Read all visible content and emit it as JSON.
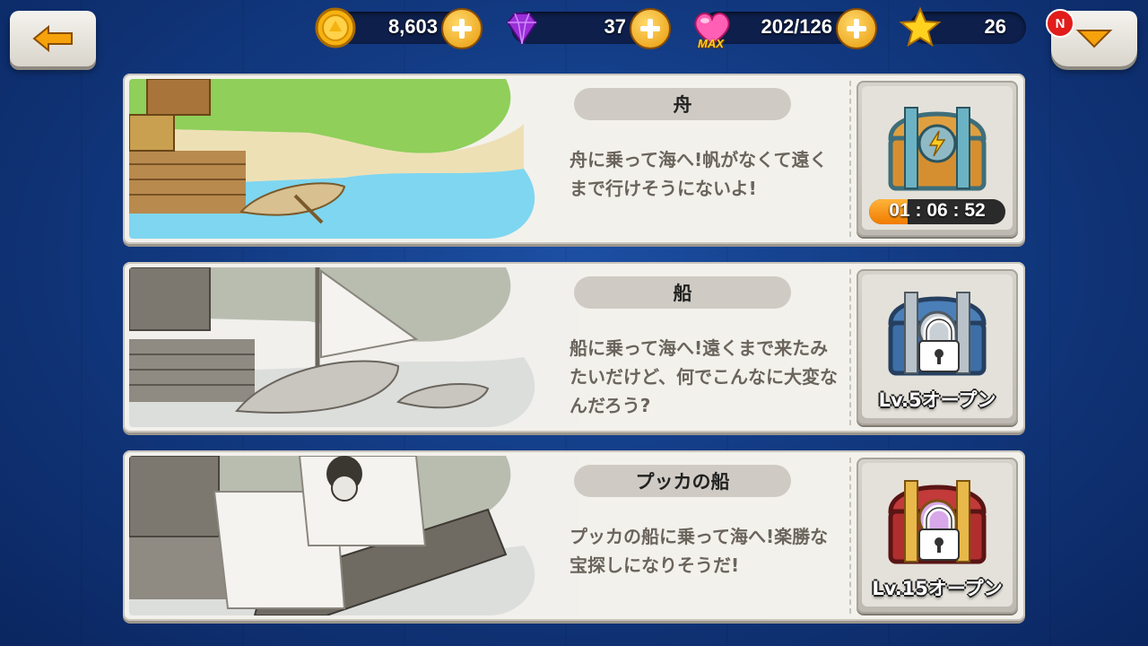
{
  "header": {
    "coins": "8,603",
    "gems": "37",
    "hearts": "202/126",
    "hearts_badge": "MAX",
    "stars": "26",
    "menu_badge": "N"
  },
  "colors": {
    "background": "#123a82",
    "card": "#f3f1ec",
    "plus": "#e89a0a",
    "badge": "#e21b1b"
  },
  "boats": [
    {
      "title": "舟",
      "description": "舟に乗って海へ!帆がなくて遠くまで行けそうにないよ!",
      "status": "01 : 06 : 52",
      "timer_progress": 0.28
    },
    {
      "title": "船",
      "description": "船に乗って海へ!遠くまで来たみたいだけど、何でこんなに大変なんだろう?",
      "status": "Lv.5オープン"
    },
    {
      "title": "プッカの船",
      "description": "プッカの船に乗って海へ!楽勝な宝探しになりそうだ!",
      "status": "Lv.15オープン"
    }
  ]
}
